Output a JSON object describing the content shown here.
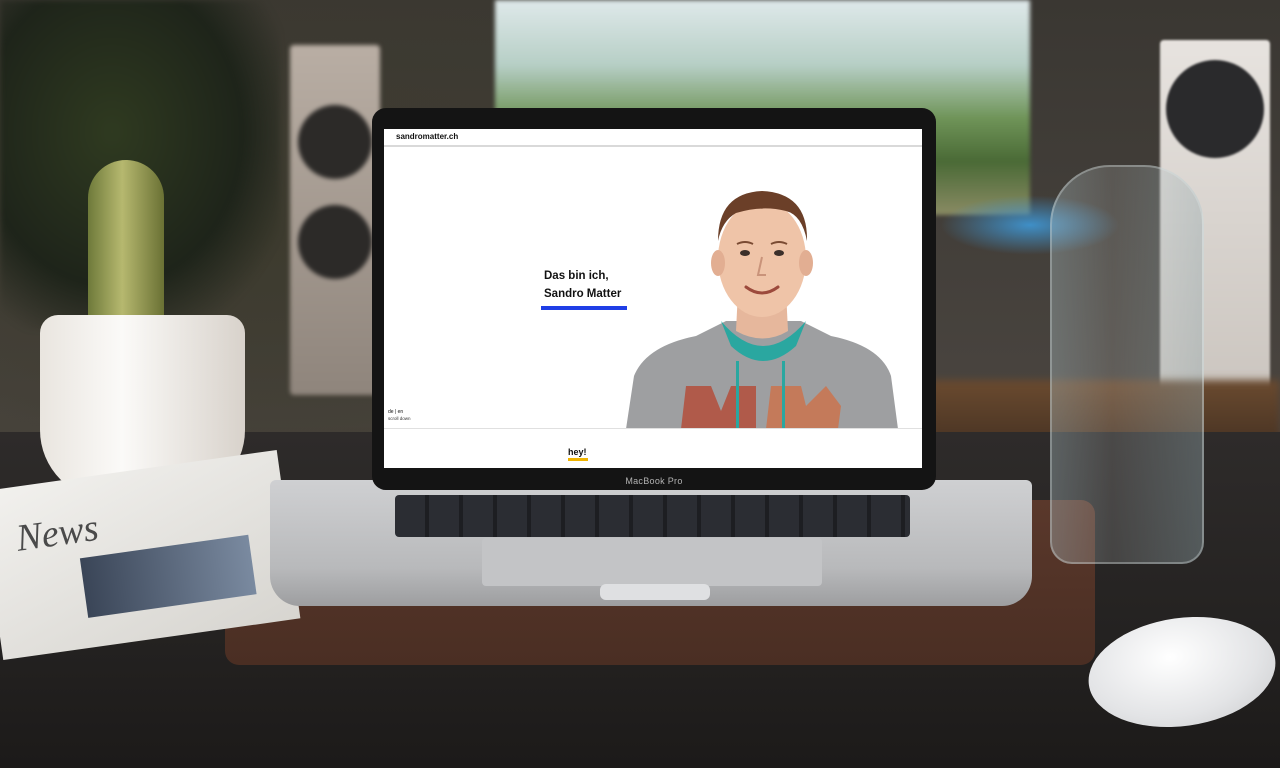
{
  "site": {
    "logo": "sandromatter.ch",
    "hero_line1": "Das bin ich,",
    "hero_line2": "Sandro Matter",
    "lang_de": "de",
    "lang_sep": "|",
    "lang_en": "en",
    "scroll_label": "scroll down",
    "section_heading": "hey!"
  },
  "device": {
    "brand": "MacBook Pro"
  },
  "desk": {
    "newspaper_masthead": "News"
  },
  "colors": {
    "accent_blue": "#1f3ee6",
    "accent_yellow": "#f0b400"
  }
}
